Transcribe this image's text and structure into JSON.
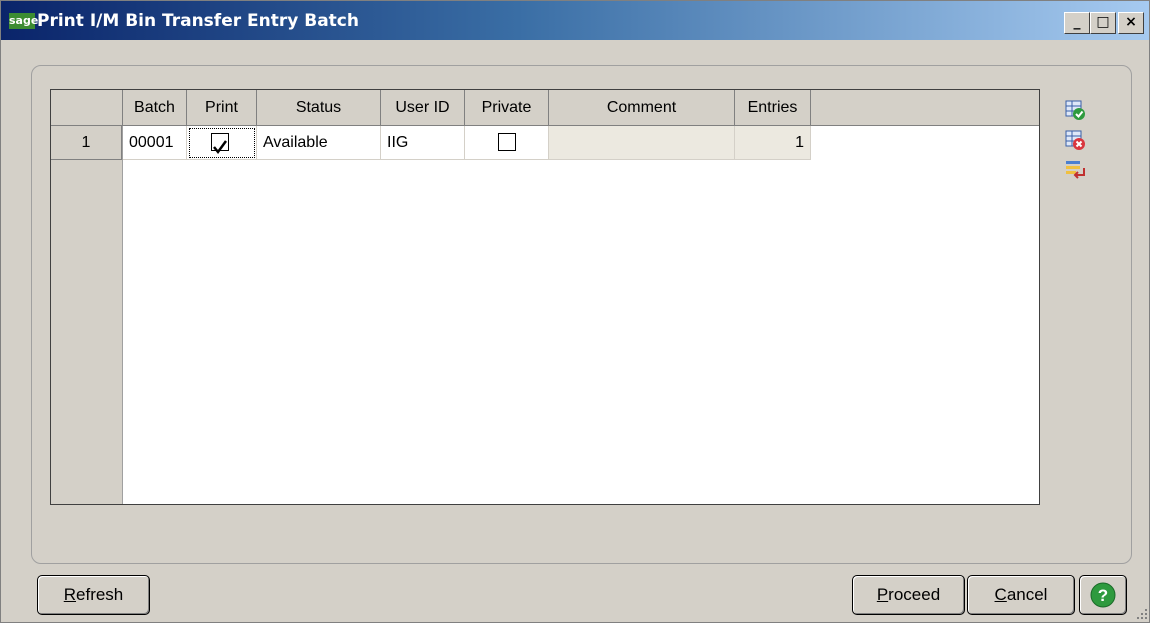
{
  "window": {
    "logo_text": "sage",
    "title": "Print I/M Bin Transfer Entry Batch",
    "controls": {
      "minimize": "_",
      "maximize": "□",
      "close": "×"
    }
  },
  "grid": {
    "columns": [
      "Batch",
      "Print",
      "Status",
      "User ID",
      "Private",
      "Comment",
      "Entries"
    ],
    "rows": [
      {
        "row_number": "1",
        "batch": "00001",
        "print": true,
        "status": "Available",
        "user_id": "IIG",
        "private": false,
        "comment": "",
        "entries": "1"
      }
    ]
  },
  "side_toolbar": {
    "icons": [
      "select-all-icon",
      "clear-all-icon",
      "reverse-selection-icon"
    ]
  },
  "buttons": {
    "refresh": {
      "mnemonic": "R",
      "rest": "efresh"
    },
    "proceed": {
      "mnemonic": "P",
      "rest": "roceed"
    },
    "cancel": {
      "mnemonic": "C",
      "rest": "ancel"
    },
    "help_icon": "help-icon"
  },
  "colors": {
    "title_start": "#0a246a",
    "title_end": "#a6caf0",
    "logo_green": "#3c8c32",
    "help_green": "#2e9a3e",
    "face": "#d4d0c8"
  }
}
